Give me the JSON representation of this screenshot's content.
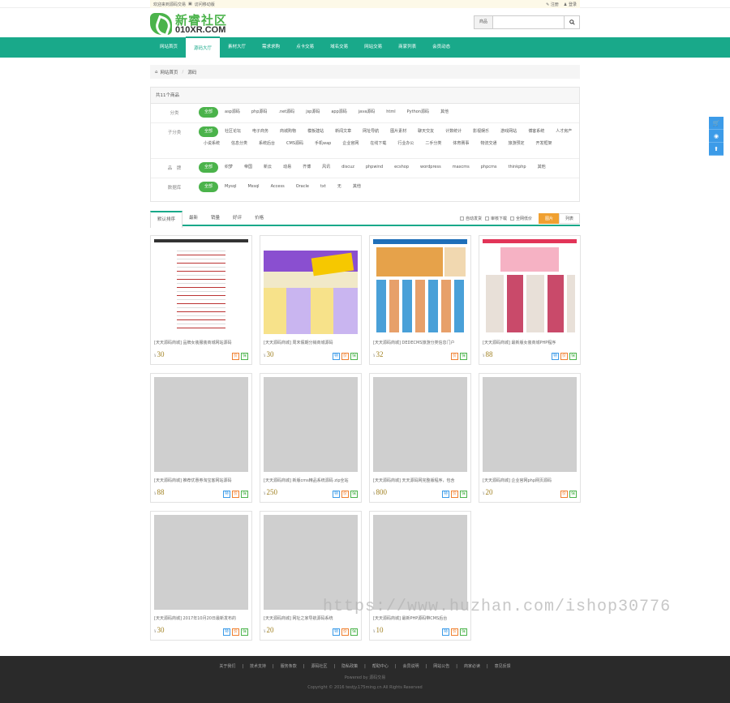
{
  "topbar": {
    "welcome": "欢迎来到源码交易",
    "mobile": "访问移动版",
    "register": "注册",
    "login": "登录"
  },
  "logo": {
    "cn": "新睿社区",
    "en": "010XR.COM"
  },
  "search": {
    "category": "商品",
    "placeholder": ""
  },
  "nav": [
    "网站首页",
    "源码大厅",
    "素材大厅",
    "需求求购",
    "点卡交易",
    "域名交易",
    "网站交易",
    "商家列表",
    "会员动态"
  ],
  "nav_active": 1,
  "breadcrumb": {
    "home": "网站首页",
    "sep": "/",
    "current": "源码"
  },
  "filter": {
    "count_text": "共11个商品",
    "rows": [
      {
        "label": "分类",
        "options": [
          "全部",
          "asp源码",
          "php源码",
          ".net源码",
          "jsp源码",
          "app源码",
          "java源码",
          "html",
          "Python源码",
          "其他"
        ]
      },
      {
        "label": "子分类",
        "options": [
          "全部",
          "社区论坛",
          "电子商务",
          "商城购物",
          "模板建站",
          "新闻文章",
          "网址导航",
          "图片素材",
          "聊天交友",
          "计数统计",
          "影视娱乐",
          "游戏网站",
          "博客系统",
          "人才房产",
          "小说系统",
          "信息分类",
          "系统后台",
          "CMS源码",
          "手机wap",
          "企业官网",
          "在线下载",
          "行业办公",
          "二手分类",
          "体育赛事",
          "物流交通",
          "旅游预定",
          "开发框架"
        ]
      },
      {
        "label": "品　牌",
        "options": [
          "全部",
          "织梦",
          "帝国",
          "新云",
          "动易",
          "齐博",
          "风讯",
          "discuz",
          "phpwind",
          "ecshop",
          "wordpress",
          "maxcms",
          "phpcms",
          "thinkphp",
          "其他"
        ]
      },
      {
        "label": "数据库",
        "options": [
          "全部",
          "Mysql",
          "Mssql",
          "Access",
          "Oracle",
          "txt",
          "无",
          "其他"
        ]
      }
    ]
  },
  "sort": {
    "tabs": [
      "默认排序",
      "最新",
      "销量",
      "好评",
      "价格"
    ],
    "checks": [
      "自动发货",
      "审核下载",
      "全网低价"
    ],
    "view": [
      "图片",
      "列表"
    ]
  },
  "products": [
    {
      "title": "[天天源码商城] 品牌女装服装商城网站源码",
      "price": "30",
      "icons": [
        "价",
        "保"
      ]
    },
    {
      "title": "[天天源码商城] 周末假期分销商城源码",
      "price": "30",
      "icons": [
        "特",
        "价",
        "保"
      ]
    },
    {
      "title": "[天天源码商城] DEDECMS旅游分类信息门户",
      "price": "32",
      "icons": [
        "价",
        "保"
      ]
    },
    {
      "title": "[天天源码商城] 最新版女装商城PHP程序",
      "price": "88",
      "icons": [
        "特",
        "价",
        "保"
      ]
    },
    {
      "title": "[天天源码商城] 推荐优惠券淘宝客网站源码",
      "price": "88",
      "icons": [
        "特",
        "价",
        "保"
      ]
    },
    {
      "title": "[天天源码商城] 新版cms精品系统源码 zip全站",
      "price": "250",
      "icons": [
        "特",
        "价",
        "保"
      ]
    },
    {
      "title": "[天天源码商城] 天天源码网完整版程序，包含",
      "price": "800",
      "icons": [
        "特",
        "价",
        "保"
      ]
    },
    {
      "title": "[天天源码商城] 企业官网php网页源码",
      "price": "20",
      "icons": [
        "价",
        "保"
      ]
    },
    {
      "title": "[天天源码商城] 2017年10月20日最新发布的",
      "price": "30",
      "icons": [
        "特",
        "价",
        "保"
      ]
    },
    {
      "title": "[天天源码商城] 网址之家导航源码系统",
      "price": "20",
      "icons": [
        "特",
        "价",
        "保"
      ]
    },
    {
      "title": "[天天源码商城] 最新PHP源码带CMS后台",
      "price": "10",
      "icons": [
        "特",
        "价",
        "保"
      ]
    }
  ],
  "currency": "¥",
  "footer": {
    "links": [
      "关于我们",
      "技术支持",
      "服务条款",
      "源码社区",
      "隐私政策",
      "帮助中心",
      "会员说明",
      "网站公告",
      "商家必读",
      "意见反馈"
    ],
    "powered": "Powered by 源码交易",
    "copyright": "Copyright © 2016 testjy.175ming.cn All Rights Reserved"
  },
  "watermark": "https://www.huzhan.com/ishop30776",
  "colors": {
    "nav": "#19a98a",
    "accent": "#4bb34b",
    "price": "#a08020"
  }
}
